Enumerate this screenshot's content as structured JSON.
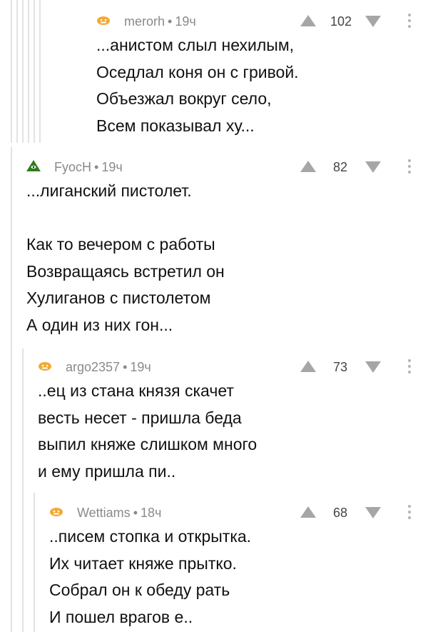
{
  "comments": [
    {
      "author": "merorh",
      "time": "19ч",
      "score": "102",
      "lines": [
        "...анистом слыл нехилым,",
        "Оседлал коня он с гривой.",
        "Объезжал вокруг село,",
        "Всем показывал ху..."
      ],
      "avatar_icon": "avatar-placeholder-icon"
    },
    {
      "author": "FyocH",
      "time": "19ч",
      "score": "82",
      "lines": [
        "...лиганский пистолет.",
        "",
        "Как то вечером с работы",
        "Возвращаясь встретил он",
        "Хулиганов с пистолетом",
        "А один из них гон..."
      ],
      "avatar_icon": "pyramid-eye-icon"
    },
    {
      "author": "argo2357",
      "time": "19ч",
      "score": "73",
      "lines": [
        "..ец из стана князя скачет",
        "весть несет - пришла беда",
        "выпил княже слишком много",
        "и ему пришла пи.."
      ],
      "avatar_icon": "avatar-placeholder-icon"
    },
    {
      "author": "Wettiams",
      "time": "18ч",
      "score": "68",
      "lines": [
        "..писем стопка и открытка.",
        "Их читает княже прытко.",
        "Собрал он к обеду рать",
        "И пошел врагов е.."
      ],
      "avatar_icon": "avatar-placeholder-icon"
    }
  ],
  "colors": {
    "meta": "#8a8a8a",
    "vote": "#a6a6a6",
    "thread_line": "#e3e3e3",
    "avatar_face": "#f3a933"
  }
}
